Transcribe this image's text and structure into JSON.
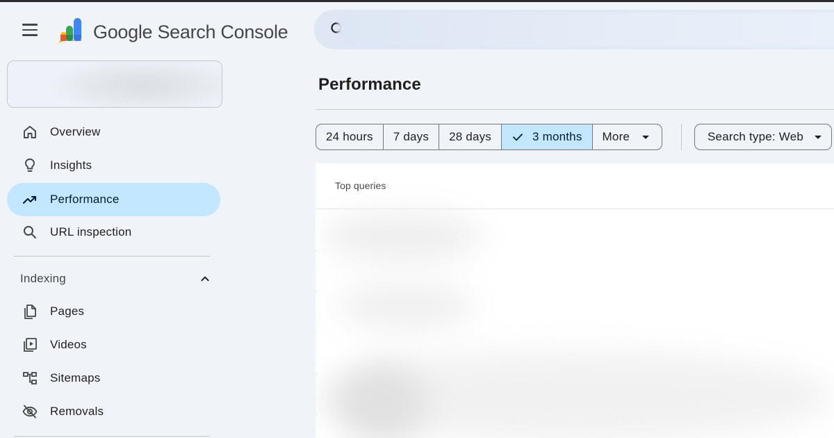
{
  "header": {
    "menu_icon": "hamburger-menu-icon",
    "product_name": "Google Search Console",
    "search": {
      "placeholder": "",
      "icon": "search-icon"
    }
  },
  "sidebar": {
    "primary_items": [
      {
        "label": "Overview",
        "icon": "home-icon"
      },
      {
        "label": "Insights",
        "icon": "lightbulb-icon"
      },
      {
        "label": "Performance",
        "icon": "trending-up-icon",
        "active": true
      },
      {
        "label": "URL inspection",
        "icon": "search-icon"
      }
    ],
    "indexing": {
      "label": "Indexing",
      "expanded": true,
      "items": [
        {
          "label": "Pages",
          "icon": "pages-icon"
        },
        {
          "label": "Videos",
          "icon": "video-icon"
        },
        {
          "label": "Sitemaps",
          "icon": "sitemap-icon"
        },
        {
          "label": "Removals",
          "icon": "visibility-off-icon"
        }
      ]
    }
  },
  "main": {
    "title": "Performance",
    "date_ranges": [
      {
        "label": "24 hours",
        "selected": false
      },
      {
        "label": "7 days",
        "selected": false
      },
      {
        "label": "28 days",
        "selected": false
      },
      {
        "label": "3 months",
        "selected": true
      }
    ],
    "more_label": "More",
    "search_type_label": "Search type: Web",
    "card": {
      "tab_label": "Top queries"
    }
  },
  "colors": {
    "background": "#f0f4f9",
    "active_nav": "#c2e7ff",
    "selected_chip": "#c2e7ff",
    "text": "#1f1f1f",
    "border": "#747775"
  }
}
